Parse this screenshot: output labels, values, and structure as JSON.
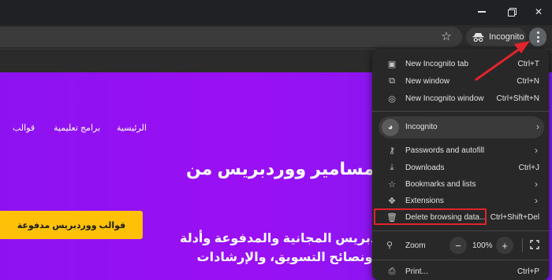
{
  "window": {
    "controls": {
      "min_icon": "minimize-icon",
      "max_icon": "restore-icon",
      "close_icon": "close-icon",
      "close_glyph": "✕"
    }
  },
  "toolbar": {
    "star_glyph": "☆",
    "incognito_label": "Incognito"
  },
  "page": {
    "nav": [
      "الرئيسية",
      "برامج تعليمية",
      "قوالب"
    ],
    "headline": "ل ومسامير ووردبريس من",
    "cta_label": "قوالب ووردبريس مدفوعة",
    "paragraph": [
      "فات ووردبريس المجانية والمدفوعة وأدلة",
      "التعليمية ونصائح التسويق، والإرشادات"
    ]
  },
  "menu": {
    "items_top": [
      {
        "icon": "new-tab-icon",
        "glyph": "▣",
        "label": "New Incognito tab",
        "shortcut": "Ctrl+T"
      },
      {
        "icon": "new-window-icon",
        "glyph": "⧉",
        "label": "New window",
        "shortcut": "Ctrl+N"
      },
      {
        "icon": "incognito-window-icon",
        "glyph": "◎",
        "label": "New Incognito window",
        "shortcut": "Ctrl+Shift+N"
      }
    ],
    "profile": {
      "label": "Incognito",
      "avatar_glyph": "◕",
      "chevron": "›"
    },
    "items_mid": [
      {
        "icon": "key-icon",
        "glyph": "⚷",
        "label": "Passwords and autofill",
        "shortcut": "",
        "chevron": "›"
      },
      {
        "icon": "download-icon",
        "glyph": "⤓",
        "label": "Downloads",
        "shortcut": "Ctrl+J",
        "chevron": ""
      },
      {
        "icon": "star-icon",
        "glyph": "☆",
        "label": "Bookmarks and lists",
        "shortcut": "",
        "chevron": "›"
      },
      {
        "icon": "extension-icon",
        "glyph": "✥",
        "label": "Extensions",
        "shortcut": "",
        "chevron": "›"
      },
      {
        "icon": "trash-icon",
        "glyph": "🗑",
        "label": "Delete browsing data...",
        "shortcut": "Ctrl+Shift+Del",
        "chevron": ""
      }
    ],
    "zoom": {
      "icon": "zoom-icon",
      "glyph": "⚲",
      "label": "Zoom",
      "minus": "−",
      "value": "100%",
      "plus": "+"
    },
    "items_bottom": [
      {
        "icon": "print-icon",
        "glyph": "⎙",
        "label": "Print...",
        "shortcut": "Ctrl+P"
      }
    ]
  },
  "annotation": {
    "arrow_color": "#e0242b",
    "highlight_color": "#e0242b"
  }
}
